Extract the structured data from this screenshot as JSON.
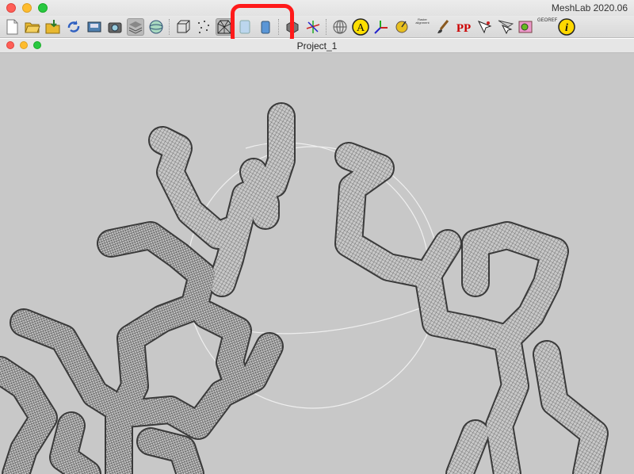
{
  "app": {
    "title": "MeshLab 2020.06"
  },
  "document": {
    "title": "Project_1"
  },
  "toolbar": {
    "buttons": [
      {
        "name": "new-project-icon"
      },
      {
        "name": "open-project-icon"
      },
      {
        "name": "import-mesh-icon"
      },
      {
        "name": "reload-icon"
      },
      {
        "name": "save-snapshot-icon"
      },
      {
        "name": "camera-icon"
      },
      {
        "name": "layers-icon"
      },
      {
        "name": "globe-icon"
      },
      {
        "name": "bbox-icon"
      },
      {
        "name": "points-icon"
      },
      {
        "name": "wireframe-icon",
        "active": true
      },
      {
        "name": "flat-shading-icon"
      },
      {
        "name": "smooth-shading-icon"
      },
      {
        "name": "texture-icon"
      },
      {
        "name": "axis-gizmo-icon"
      },
      {
        "name": "sphere-grid-icon"
      },
      {
        "name": "annotate-icon"
      },
      {
        "name": "axes-icon"
      },
      {
        "name": "measure-tool-icon"
      },
      {
        "name": "raster-alignment-icon"
      },
      {
        "name": "paint-brush-icon"
      },
      {
        "name": "pickpoints-icon"
      },
      {
        "name": "select-vertices-icon"
      },
      {
        "name": "select-faces-icon"
      },
      {
        "name": "edit-texture-icon"
      },
      {
        "name": "georef-icon"
      },
      {
        "name": "info-icon"
      }
    ],
    "annotate_label": "A",
    "raster_label": "Raster alignment",
    "pickpoints_label": "PP",
    "georef_label": "GEOREF",
    "info_label": "i"
  },
  "colors": {
    "viewport_bg": "#c8c8c8",
    "mesh": "#3a3a3a",
    "highlight": "#ff1a1a"
  }
}
